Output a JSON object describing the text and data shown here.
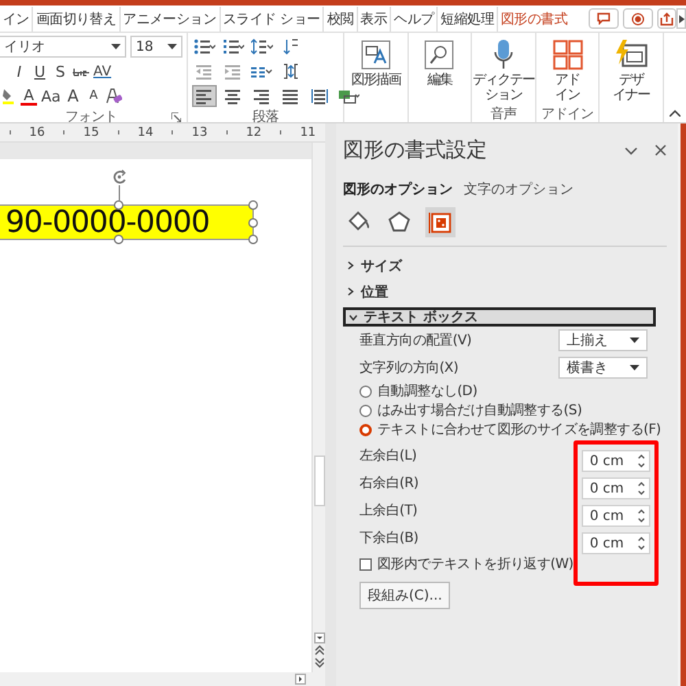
{
  "ribbon_tabs": [
    {
      "label": "イン",
      "selected": false
    },
    {
      "label": "画面切り替え",
      "selected": false
    },
    {
      "label": "アニメーション",
      "selected": false
    },
    {
      "label": "スライド ショー",
      "selected": false
    },
    {
      "label": "校閲",
      "selected": false
    },
    {
      "label": "表示",
      "selected": false
    },
    {
      "label": "ヘルプ",
      "selected": false
    },
    {
      "label": "短縮処理",
      "selected": false
    },
    {
      "label": "図形の書式",
      "selected": true
    }
  ],
  "font_group": {
    "font": "イリオ",
    "size": "18",
    "format_buttons": [
      "I",
      "U",
      "S"
    ],
    "spacing_button": "AV",
    "font_color_button": "A",
    "case_button": "Aa",
    "size_buttons": [
      "A",
      "A"
    ],
    "label": "フォント"
  },
  "paragraph_group": {
    "label": "段落",
    "alignment_buttons": [
      {
        "kind": "left",
        "selected": true
      },
      {
        "kind": "center",
        "selected": false
      },
      {
        "kind": "right",
        "selected": false
      },
      {
        "kind": "justify",
        "selected": false
      },
      {
        "kind": "distributed",
        "selected": false
      }
    ]
  },
  "large_buttons": [
    {
      "kind": "shapes",
      "lines": [
        "図形描画"
      ]
    },
    {
      "kind": "find",
      "lines": [
        "編集"
      ]
    },
    {
      "kind": "mic",
      "lines": [
        "ディクテー",
        "ション"
      ],
      "group": "音声"
    },
    {
      "kind": "addins",
      "lines": [
        "アド",
        "イン"
      ],
      "group": "アドイン"
    },
    {
      "kind": "designer",
      "lines": [
        "デザ",
        "イナー"
      ]
    }
  ],
  "ruler": [
    "16",
    "15",
    "14",
    "13",
    "12",
    "11"
  ],
  "slide": {
    "text_box": "90-0000-0000"
  },
  "pane": {
    "title": "図形の書式設定",
    "option_tabs": [
      {
        "label": "図形のオプション",
        "selected": true
      },
      {
        "label": "文字のオプション",
        "selected": false
      }
    ],
    "icon_tabs": [
      {
        "kind": "fill",
        "selected": false
      },
      {
        "kind": "effects",
        "selected": false
      },
      {
        "kind": "size",
        "selected": true
      }
    ],
    "sections": [
      {
        "label": "サイズ",
        "expanded": false
      },
      {
        "label": "位置",
        "expanded": false
      },
      {
        "label": "テキスト ボックス",
        "expanded": true
      }
    ],
    "dropdowns": [
      {
        "label": "垂直方向の配置(V)",
        "value": "上揃え"
      },
      {
        "label": "文字列の方向(X)",
        "value": "横書き"
      }
    ],
    "autofit": [
      {
        "label": "自動調整なし(D)",
        "selected": false
      },
      {
        "label": "はみ出す場合だけ自動調整する(S)",
        "selected": false
      },
      {
        "label": "テキストに合わせて図形のサイズを調整する(F)",
        "selected": true
      }
    ],
    "margins": [
      {
        "label": "左余白(L)",
        "value": "0 cm"
      },
      {
        "label": "右余白(R)",
        "value": "0 cm"
      },
      {
        "label": "上余白(T)",
        "value": "0 cm"
      },
      {
        "label": "下余白(B)",
        "value": "0 cm"
      }
    ],
    "wrap": {
      "label": "図形内でテキストを折り返す(W)",
      "checked": false
    },
    "columns_button": "段組み(C)..."
  }
}
